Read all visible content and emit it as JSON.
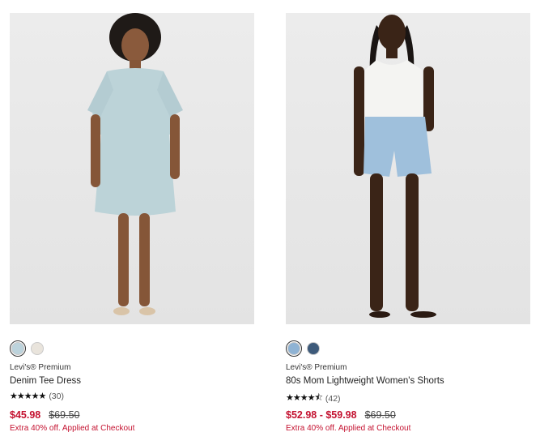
{
  "products": [
    {
      "brand": "Levi's® Premium",
      "name": "Denim Tee Dress",
      "stars": "★★★★★",
      "rating_value": 5,
      "review_count": "(30)",
      "sale_price": "$45.98",
      "original_price": "$69.50",
      "promo": "Extra 40% off. Applied at Checkout",
      "swatches": [
        "#bcd3dc",
        "#e9e4dc"
      ],
      "selected_swatch": 0
    },
    {
      "brand": "Levi's® Premium",
      "name": "80s Mom Lightweight Women's Shorts",
      "stars": "★★★★⯪",
      "rating_value": 4.5,
      "review_count": "(42)",
      "sale_price": "$52.98 - $59.98",
      "original_price": "$69.50",
      "promo": "Extra 40% off. Applied at Checkout",
      "swatches": [
        "#8fb3d4",
        "#3d5a7a"
      ],
      "selected_swatch": 0
    }
  ],
  "colors": {
    "sale": "#c41230",
    "background": "#ffffff",
    "photo_bg": "#e6e6e6"
  }
}
